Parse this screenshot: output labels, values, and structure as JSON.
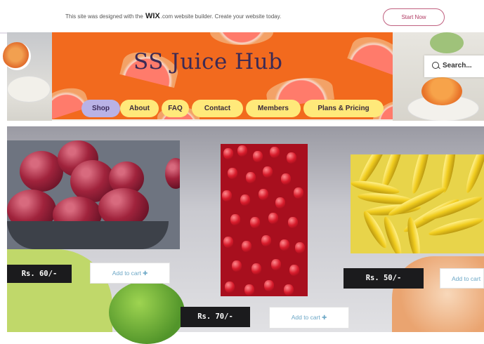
{
  "wix_banner": {
    "message_before": "This site was designed with the ",
    "brand": "WIX",
    "message_after": ".com website builder. Create your website today.",
    "cta": "Start Now"
  },
  "site": {
    "title": "SS Juice Hub"
  },
  "search": {
    "placeholder": "Search..."
  },
  "nav": {
    "items": [
      {
        "label": "Shop",
        "active": true
      },
      {
        "label": "About",
        "active": false
      },
      {
        "label": "FAQ",
        "active": false
      },
      {
        "label": "Contact",
        "active": false
      },
      {
        "label": "Members",
        "active": false
      },
      {
        "label": "Plans & Pricing",
        "active": false
      }
    ]
  },
  "products": [
    {
      "name": "apples",
      "price": "Rs. 60/-",
      "cart": "Add to cart ✚"
    },
    {
      "name": "pomegranate",
      "price": "Rs. 70/-",
      "cart": "Add to cart ✚"
    },
    {
      "name": "bananas",
      "price": "Rs. 50/-",
      "cart": "Add to cart"
    }
  ],
  "colors": {
    "banner_orange": "#f26a1e",
    "title_purple": "#3b2a55",
    "nav_yellow": "#ffe97a",
    "nav_active": "#b9b2e6",
    "price_bg": "#1b1b1d",
    "cart_text": "#6ca7c6",
    "cta_border": "#c0607f"
  }
}
